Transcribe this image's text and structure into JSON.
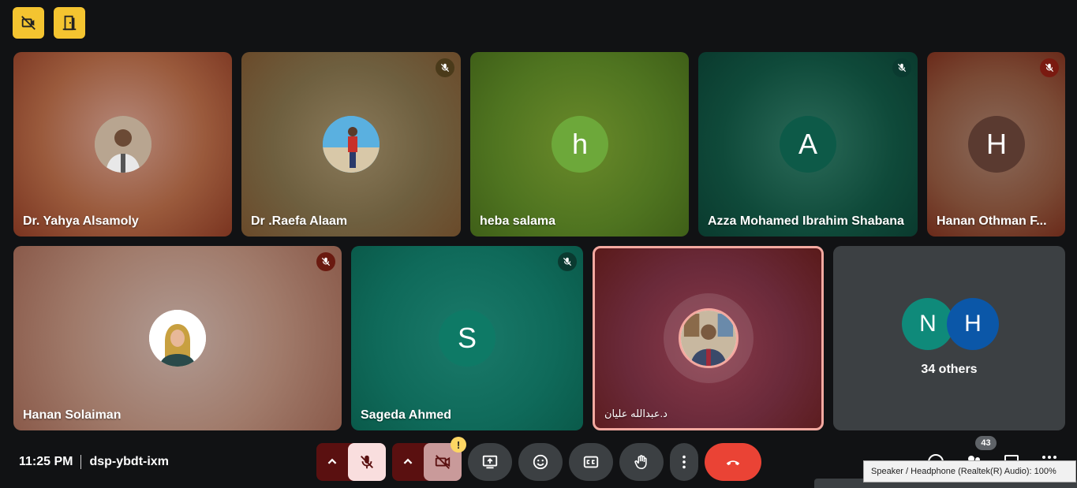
{
  "meeting": {
    "time": "11:25 PM",
    "code": "dsp-ybdt-ixm",
    "participant_count": "43"
  },
  "tiles_row1": [
    {
      "name": "Dr. Yahya Alsamoly",
      "initial": "",
      "muted": false
    },
    {
      "name": "Dr .Raefa Alaam",
      "initial": "",
      "muted": true
    },
    {
      "name": "heba salama",
      "initial": "h",
      "muted": false
    },
    {
      "name": "Azza Mohamed Ibrahim Shabana",
      "initial": "A",
      "muted": true
    },
    {
      "name": "Hanan Othman F...",
      "initial": "H",
      "muted": true
    }
  ],
  "tiles_row2": [
    {
      "name": "Hanan Solaiman",
      "initial": "",
      "muted": true
    },
    {
      "name": "Sageda Ahmed",
      "initial": "S",
      "muted": true
    },
    {
      "name": "د.عبدالله عليان",
      "initial": "",
      "muted": false
    }
  ],
  "others": {
    "initials": [
      "N",
      "H"
    ],
    "label": "34 others"
  },
  "tooltip": "Speaker / Headphone (Realtek(R) Audio): 100%",
  "colors": {
    "accent_yellow": "#f4c430",
    "end_call": "#ea4335",
    "mic_off_bg": "#f9dede",
    "control_bg": "#3c4043"
  },
  "icons": {
    "top_left_1": "video-off-icon",
    "top_left_2": "door-icon",
    "warning_badge": "!"
  }
}
